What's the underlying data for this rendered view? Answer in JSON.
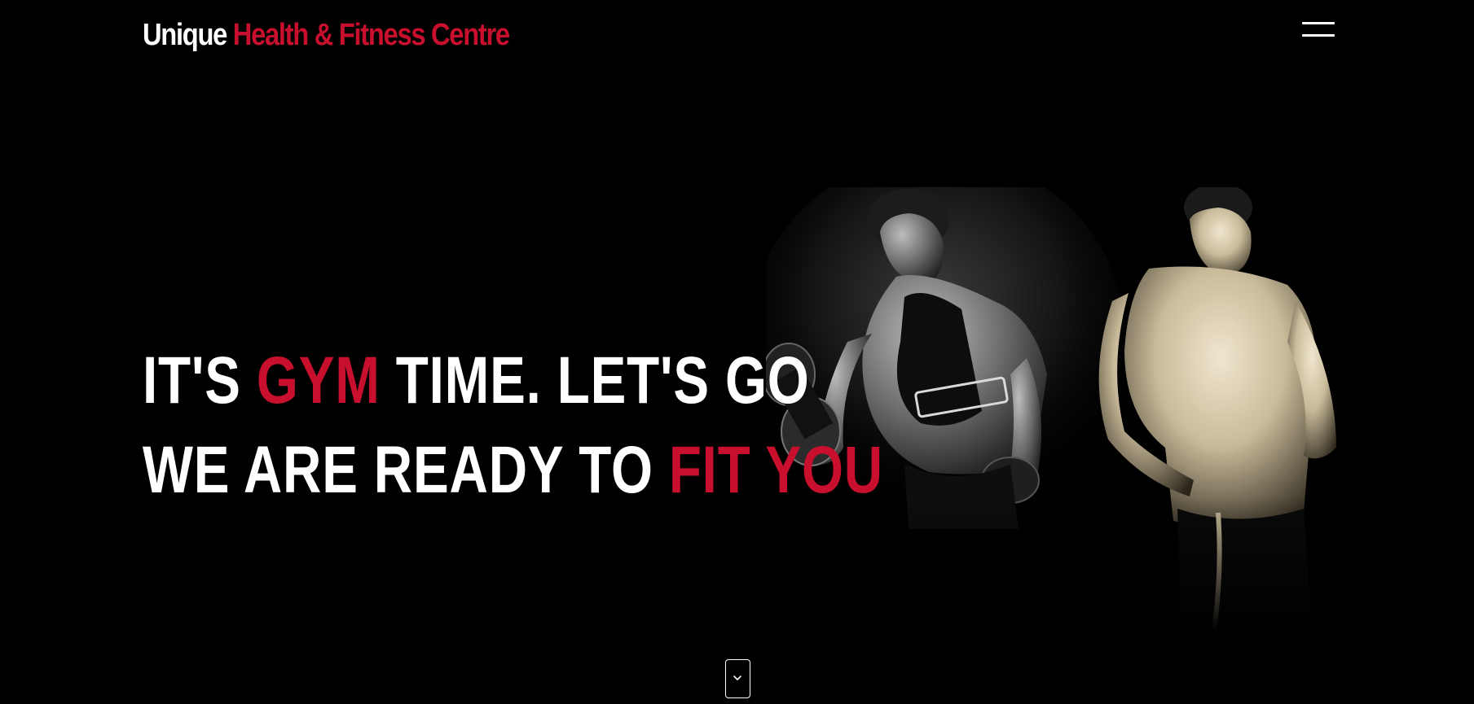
{
  "header": {
    "logo_part1": "Unique",
    "logo_part2": "Health & Fitness Centre",
    "menu_icon": "hamburger-menu-icon"
  },
  "hero": {
    "line1": {
      "part1": "IT'S ",
      "part2": "GYM",
      "part3": " TIME. LET'S GO"
    },
    "line2": {
      "part1": "WE ARE READY TO ",
      "part2": "FIT YOU"
    },
    "image_alt": "two bodybuilders, one curling a dumbbell"
  },
  "scroll_indicator": {
    "icon": "chevron-down-icon"
  },
  "colors": {
    "background": "#000000",
    "accent": "#c8102e",
    "text": "#ffffff"
  }
}
